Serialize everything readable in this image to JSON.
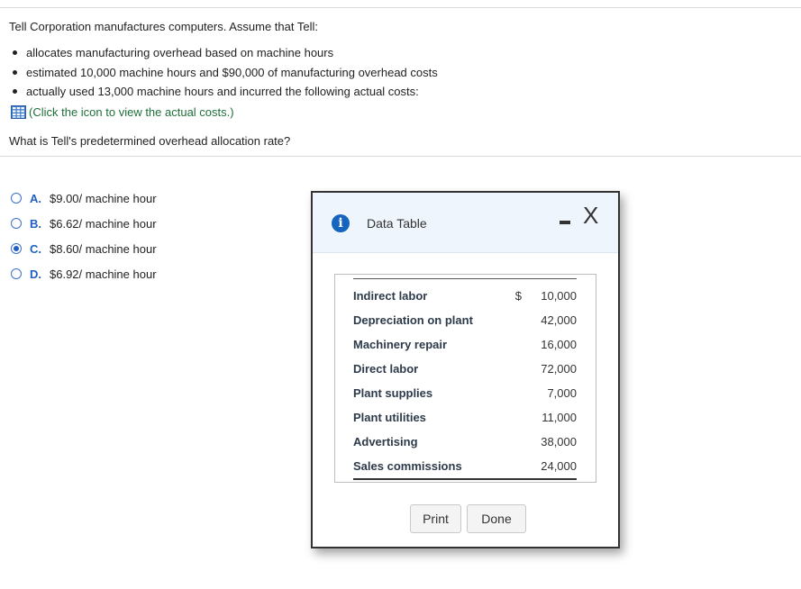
{
  "problem": {
    "intro": "Tell Corporation manufactures computers. Assume that Tell:",
    "bullets": [
      "allocates manufacturing overhead based on machine hours",
      "estimated 10,000 machine hours and $90,000 of manufacturing overhead costs",
      "actually used 13,000 machine hours and incurred the following actual costs:"
    ],
    "icon_link": "(Click the icon to view the actual costs.)",
    "question": "What is Tell's predetermined overhead allocation rate?"
  },
  "choices": [
    {
      "letter": "A.",
      "text": "$9.00/ machine hour",
      "selected": false
    },
    {
      "letter": "B.",
      "text": "$6.62/ machine hour",
      "selected": false
    },
    {
      "letter": "C.",
      "text": "$8.60/ machine hour",
      "selected": true
    },
    {
      "letter": "D.",
      "text": "$6.92/ machine hour",
      "selected": false
    }
  ],
  "dialog": {
    "title": "Data Table",
    "close_glyph": "X",
    "info_glyph": "i",
    "rows": [
      {
        "label": "Indirect labor",
        "currency": "$",
        "amount": "10,000"
      },
      {
        "label": "Depreciation on plant",
        "currency": "",
        "amount": "42,000"
      },
      {
        "label": "Machinery repair",
        "currency": "",
        "amount": "16,000"
      },
      {
        "label": "Direct labor",
        "currency": "",
        "amount": "72,000"
      },
      {
        "label": "Plant supplies",
        "currency": "",
        "amount": "7,000"
      },
      {
        "label": "Plant utilities",
        "currency": "",
        "amount": "11,000"
      },
      {
        "label": "Advertising",
        "currency": "",
        "amount": "38,000"
      },
      {
        "label": "Sales commissions",
        "currency": "",
        "amount": "24,000"
      }
    ],
    "print_label": "Print",
    "done_label": "Done"
  },
  "icons": {
    "table": "table-icon",
    "info": "info-icon",
    "minimize": "minimize-icon",
    "close": "close-icon"
  },
  "colors": {
    "link_green": "#1f6f3a",
    "choice_blue": "#1f5fc2",
    "info_blue": "#1565c0",
    "dialog_header": "#eef5fc"
  }
}
